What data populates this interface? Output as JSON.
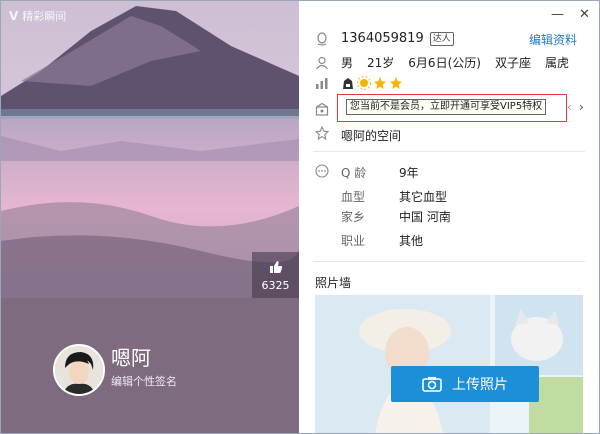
{
  "brand": {
    "name": "精彩瞬间"
  },
  "window": {
    "minimize": "—",
    "close": "✕"
  },
  "likes": {
    "count": "6325"
  },
  "profile": {
    "nickname": "嗯阿",
    "signature": "编辑个性签名"
  },
  "account": {
    "qq_number": "1364059819",
    "badge": "达人",
    "edit_label": "编辑资料"
  },
  "basic_info": [
    "男",
    "21岁",
    "6月6日(公历)",
    "双子座",
    "属虎"
  ],
  "vip_tooltip": "您当前不是会员，立即开通可享受VIP5特权",
  "space_link": "嗯阿的空间",
  "details": [
    {
      "key": "Q 龄",
      "value": "9年"
    },
    {
      "key": "血型",
      "value": "其它血型"
    },
    {
      "key": "家乡",
      "value": "中国 河南"
    },
    {
      "key": "职业",
      "value": "其他"
    }
  ],
  "photo_wall": {
    "title": "照片墙",
    "upload_label": "上传照片"
  },
  "colors": {
    "accent": "#1c8fd8",
    "link": "#1f7bd1",
    "tooltip_border": "#e23a3a",
    "profile_bg": "#7e6b80"
  },
  "icons": [
    "qq-penguin-icon",
    "person-icon",
    "level-icon",
    "gift-icon",
    "star-icon",
    "more-icon",
    "thumb-up-icon",
    "camera-icon"
  ]
}
